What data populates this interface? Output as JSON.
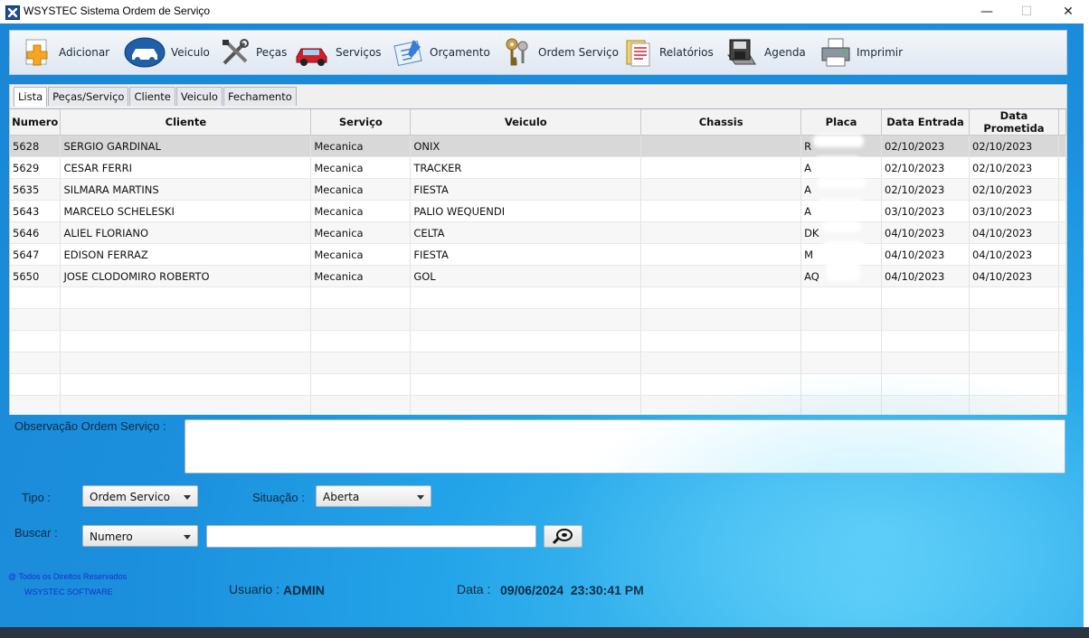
{
  "window": {
    "title": "WSYSTEC Sistema Ordem de Serviço",
    "controls": {
      "minimize": "—",
      "maximize": "☐",
      "close": "✕"
    }
  },
  "toolbar": {
    "items": [
      {
        "label": "Adicionar",
        "icon": "add-plus-icon"
      },
      {
        "label": "Veiculo",
        "icon": "car-icon"
      },
      {
        "label": "Peças",
        "icon": "tools-icon"
      },
      {
        "label": "Serviços",
        "icon": "car-service-icon"
      },
      {
        "label": "Orçamento",
        "icon": "budget-icon"
      },
      {
        "label": "Ordem Serviço",
        "icon": "keys-icon"
      },
      {
        "label": "Relatórios",
        "icon": "reports-icon"
      },
      {
        "label": "Agenda",
        "icon": "floppy-icon"
      },
      {
        "label": "Imprimir",
        "icon": "printer-icon"
      }
    ]
  },
  "tabs": [
    "Lista",
    "Peças/Serviço",
    "Cliente",
    "Veiculo",
    "Fechamento"
  ],
  "table": {
    "columns": [
      "Numero",
      "Cliente",
      "Serviço",
      "Veiculo",
      "Chassis",
      "Placa",
      "Data Entrada",
      "Data Prometida"
    ],
    "rows": [
      {
        "numero": "5628",
        "cliente": "SERGIO GARDINAL",
        "servico": "Mecanica",
        "veiculo": "ONIX",
        "chassis": "",
        "placa": "R",
        "entrada": "02/10/2023",
        "prometida": "02/10/2023"
      },
      {
        "numero": "5629",
        "cliente": "CESAR FERRI",
        "servico": "Mecanica",
        "veiculo": "TRACKER",
        "chassis": "",
        "placa": "A",
        "entrada": "02/10/2023",
        "prometida": "02/10/2023"
      },
      {
        "numero": "5635",
        "cliente": "SILMARA MARTINS",
        "servico": "Mecanica",
        "veiculo": "FIESTA",
        "chassis": "",
        "placa": "A",
        "entrada": "02/10/2023",
        "prometida": "02/10/2023"
      },
      {
        "numero": "5643",
        "cliente": "MARCELO SCHELESKI",
        "servico": "Mecanica",
        "veiculo": "PALIO WEQUENDI",
        "chassis": "",
        "placa": "A",
        "entrada": "03/10/2023",
        "prometida": "03/10/2023"
      },
      {
        "numero": "5646",
        "cliente": "ALIEL FLORIANO",
        "servico": "Mecanica",
        "veiculo": "CELTA",
        "chassis": "",
        "placa": "DK",
        "entrada": "04/10/2023",
        "prometida": "04/10/2023"
      },
      {
        "numero": "5647",
        "cliente": "EDISON FERRAZ",
        "servico": "Mecanica",
        "veiculo": "FIESTA",
        "chassis": "",
        "placa": "M",
        "entrada": "04/10/2023",
        "prometida": "04/10/2023"
      },
      {
        "numero": "5650",
        "cliente": "JOSE CLODOMIRO ROBERTO",
        "servico": "Mecanica",
        "veiculo": "GOL",
        "chassis": "",
        "placa": "AQ",
        "entrada": "04/10/2023",
        "prometida": "04/10/2023"
      }
    ],
    "empty_rows": 6
  },
  "form": {
    "observacao_label": "Observação Ordem Serviço :",
    "tipo_label": "Tipo :",
    "tipo_value": "Ordem Servico",
    "situacao_label": "Situação :",
    "situacao_value": "Aberta",
    "buscar_label": "Buscar :",
    "buscar_value": "Numero",
    "search_icon": "search-magnifier-icon"
  },
  "footer": {
    "copyright": "@ Todos os Direitos Reservados",
    "company": "WSYSTEC SOFTWARE",
    "usuario_label": "Usuario :",
    "usuario_value": "ADMIN",
    "data_label": "Data :",
    "data_value": "09/06/2024  23:30:41 PM"
  },
  "colors": {
    "background_blue": "#1b8fdc",
    "accent_light": "#52c8f5",
    "selected_row": "#d8d8d8"
  }
}
